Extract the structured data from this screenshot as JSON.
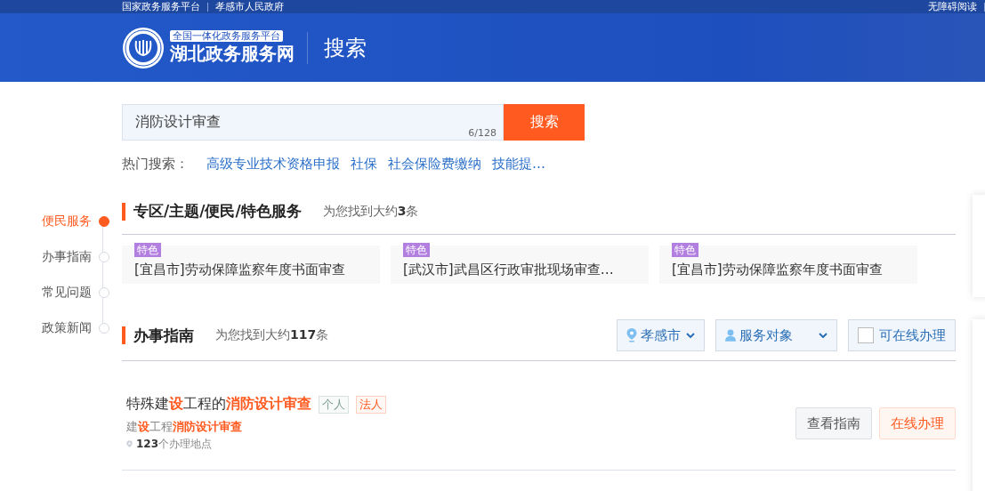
{
  "top_bar": {
    "links": [
      "国家政务服务平台",
      "孝感市人民政府"
    ],
    "right_links": [
      "无障碍阅读"
    ]
  },
  "header": {
    "logo_badge": "全国一体化政务服务平台",
    "logo_title": "湖北政务服务网",
    "page_title": "搜索"
  },
  "search": {
    "value": "消防设计审查",
    "counter": "6/128",
    "button": "搜索"
  },
  "hot_search": {
    "label": "热门搜索：",
    "items": [
      "高级专业技术资格申报",
      "社保",
      "社会保险费缴纳",
      "技能提…"
    ]
  },
  "side_nav": [
    {
      "label": "便民服务",
      "selected": true
    },
    {
      "label": "办事指南",
      "selected": false
    },
    {
      "label": "常见问题",
      "selected": false
    },
    {
      "label": "政策新闻",
      "selected": false
    }
  ],
  "special_section": {
    "title": "专区/主题/便民/特色服务",
    "count": "为您找到大约**3**条",
    "cards": [
      {
        "tag": "特色",
        "title": "[宜昌市]劳动保障监察年度书面审查"
      },
      {
        "tag": "特色",
        "title": "[武汉市]武昌区行政审批现场审查…"
      },
      {
        "tag": "特色",
        "title": "[宜昌市]劳动保障监察年度书面审查"
      }
    ]
  },
  "guide_section": {
    "title": "办事指南",
    "count": "为您找到大约**117**条",
    "filters": {
      "region": "孝感市",
      "audience": "服务对象",
      "online_only": {
        "label": "可在线办理",
        "checked": false
      }
    },
    "results": [
      {
        "title": "特殊建**设**工程的**消防设计审查**",
        "tags": [
          {
            "label": "个人",
            "color": "#7a9d90"
          },
          {
            "label": "法人",
            "color": "#ff5a1f"
          }
        ],
        "subtitle": "建**设**工程**消防设计审查**",
        "locations": "**123**个办理地点",
        "buttons": [
          "查看指南",
          "在线办理"
        ]
      }
    ]
  }
}
